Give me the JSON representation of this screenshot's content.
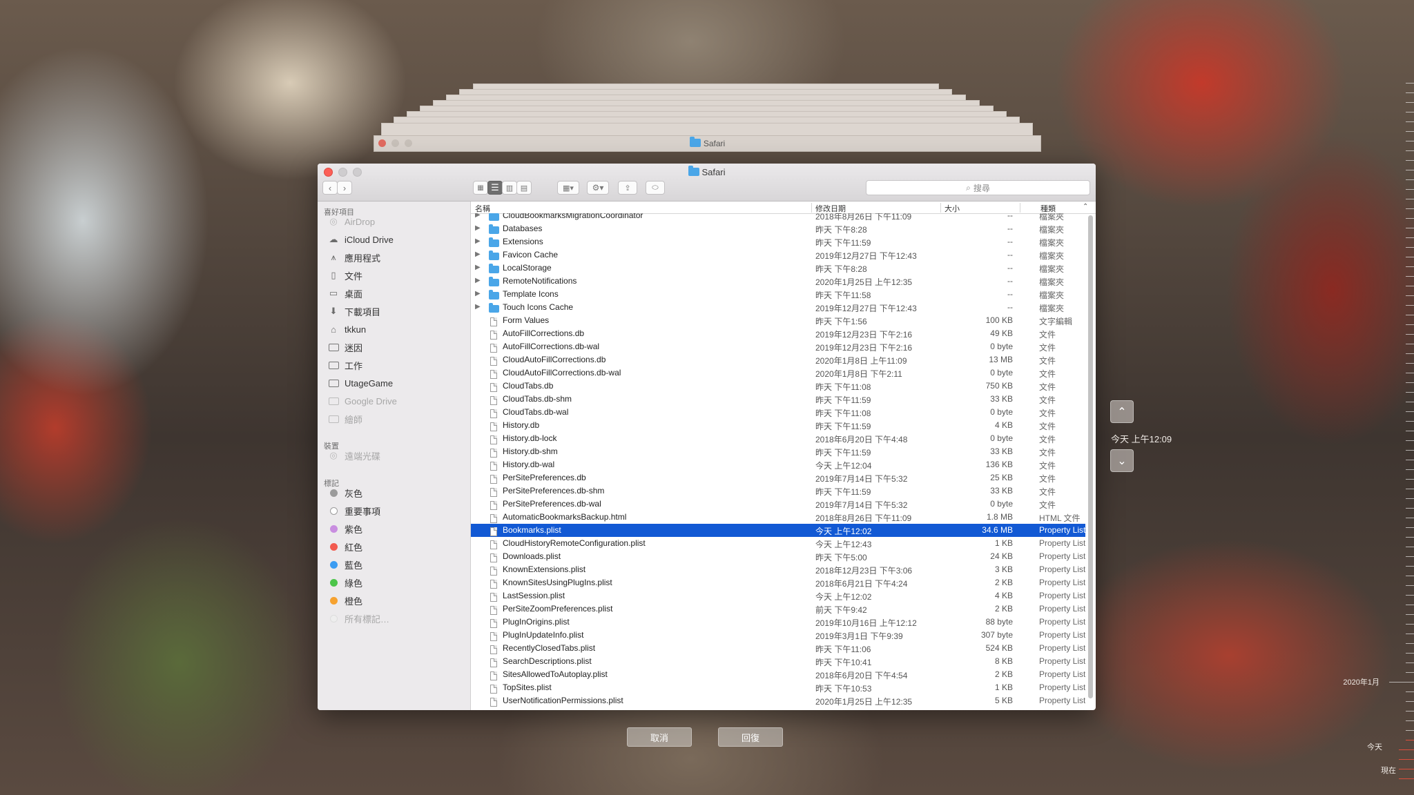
{
  "window": {
    "title": "Safari",
    "back_title": "Safari"
  },
  "toolbar": {
    "search_placeholder": "搜尋"
  },
  "sidebar": {
    "favorites_header": "喜好項目",
    "favorites": [
      {
        "label": "AirDrop",
        "icon": "airdrop-icon",
        "dim": true
      },
      {
        "label": "iCloud Drive",
        "icon": "cloud-icon"
      },
      {
        "label": "應用程式",
        "icon": "applications-icon"
      },
      {
        "label": "文件",
        "icon": "document-icon"
      },
      {
        "label": "桌面",
        "icon": "desktop-icon"
      },
      {
        "label": "下載項目",
        "icon": "downloads-icon"
      },
      {
        "label": "tkkun",
        "icon": "home-icon"
      },
      {
        "label": "迷因",
        "icon": "folder-icon"
      },
      {
        "label": "工作",
        "icon": "folder-icon"
      },
      {
        "label": "UtageGame",
        "icon": "folder-icon"
      },
      {
        "label": "Google Drive",
        "icon": "folder-icon",
        "dim": true
      },
      {
        "label": "繪師",
        "icon": "folder-icon",
        "dim": true
      }
    ],
    "devices_header": "裝置",
    "devices": [
      {
        "label": "遠端光碟",
        "icon": "disc-icon",
        "dim": true
      }
    ],
    "tags_header": "標記",
    "tags": [
      {
        "label": "灰色",
        "color": "#9b9b9b"
      },
      {
        "label": "重要事項",
        "color": "#ffffff"
      },
      {
        "label": "紫色",
        "color": "#c98ee0"
      },
      {
        "label": "紅色",
        "color": "#f25a4f"
      },
      {
        "label": "藍色",
        "color": "#3b9cf2"
      },
      {
        "label": "綠色",
        "color": "#4cc54a"
      },
      {
        "label": "橙色",
        "color": "#f6a230"
      },
      {
        "label": "所有標記…",
        "color": "",
        "dim": true
      }
    ]
  },
  "columns": {
    "name": "名稱",
    "date": "修改日期",
    "size": "大小",
    "kind": "種類"
  },
  "files": [
    {
      "name": "CloudBookmarksMigrationCoordinator",
      "date": "2018年8月26日 下午11:09",
      "size": "--",
      "kind": "檔案夾",
      "folder": true
    },
    {
      "name": "Databases",
      "date": "昨天 下午8:28",
      "size": "--",
      "kind": "檔案夾",
      "folder": true
    },
    {
      "name": "Extensions",
      "date": "昨天 下午11:59",
      "size": "--",
      "kind": "檔案夾",
      "folder": true
    },
    {
      "name": "Favicon Cache",
      "date": "2019年12月27日 下午12:43",
      "size": "--",
      "kind": "檔案夾",
      "folder": true
    },
    {
      "name": "LocalStorage",
      "date": "昨天 下午8:28",
      "size": "--",
      "kind": "檔案夾",
      "folder": true
    },
    {
      "name": "RemoteNotifications",
      "date": "2020年1月25日 上午12:35",
      "size": "--",
      "kind": "檔案夾",
      "folder": true
    },
    {
      "name": "Template Icons",
      "date": "昨天 下午11:58",
      "size": "--",
      "kind": "檔案夾",
      "folder": true
    },
    {
      "name": "Touch Icons Cache",
      "date": "2019年12月27日 下午12:43",
      "size": "--",
      "kind": "檔案夾",
      "folder": true
    },
    {
      "name": "Form Values",
      "date": "昨天 下午1:56",
      "size": "100 KB",
      "kind": "文字編輯"
    },
    {
      "name": "AutoFillCorrections.db",
      "date": "2019年12月23日 下午2:16",
      "size": "49 KB",
      "kind": "文件"
    },
    {
      "name": "AutoFillCorrections.db-wal",
      "date": "2019年12月23日 下午2:16",
      "size": "0 byte",
      "kind": "文件"
    },
    {
      "name": "CloudAutoFillCorrections.db",
      "date": "2020年1月8日 上午11:09",
      "size": "13 MB",
      "kind": "文件"
    },
    {
      "name": "CloudAutoFillCorrections.db-wal",
      "date": "2020年1月8日 下午2:11",
      "size": "0 byte",
      "kind": "文件"
    },
    {
      "name": "CloudTabs.db",
      "date": "昨天 下午11:08",
      "size": "750 KB",
      "kind": "文件"
    },
    {
      "name": "CloudTabs.db-shm",
      "date": "昨天 下午11:59",
      "size": "33 KB",
      "kind": "文件"
    },
    {
      "name": "CloudTabs.db-wal",
      "date": "昨天 下午11:08",
      "size": "0 byte",
      "kind": "文件"
    },
    {
      "name": "History.db",
      "date": "昨天 下午11:59",
      "size": "4 KB",
      "kind": "文件"
    },
    {
      "name": "History.db-lock",
      "date": "2018年6月20日 下午4:48",
      "size": "0 byte",
      "kind": "文件"
    },
    {
      "name": "History.db-shm",
      "date": "昨天 下午11:59",
      "size": "33 KB",
      "kind": "文件"
    },
    {
      "name": "History.db-wal",
      "date": "今天 上午12:04",
      "size": "136 KB",
      "kind": "文件"
    },
    {
      "name": "PerSitePreferences.db",
      "date": "2019年7月14日 下午5:32",
      "size": "25 KB",
      "kind": "文件"
    },
    {
      "name": "PerSitePreferences.db-shm",
      "date": "昨天 下午11:59",
      "size": "33 KB",
      "kind": "文件"
    },
    {
      "name": "PerSitePreferences.db-wal",
      "date": "2019年7月14日 下午5:32",
      "size": "0 byte",
      "kind": "文件"
    },
    {
      "name": "AutomaticBookmarksBackup.html",
      "date": "2018年8月26日 下午11:09",
      "size": "1.8 MB",
      "kind": "HTML 文件"
    },
    {
      "name": "Bookmarks.plist",
      "date": "今天 上午12:02",
      "size": "34.6 MB",
      "kind": "Property List",
      "selected": true
    },
    {
      "name": "CloudHistoryRemoteConfiguration.plist",
      "date": "今天 上午12:43",
      "size": "1 KB",
      "kind": "Property List"
    },
    {
      "name": "Downloads.plist",
      "date": "昨天 下午5:00",
      "size": "24 KB",
      "kind": "Property List"
    },
    {
      "name": "KnownExtensions.plist",
      "date": "2018年12月23日 下午3:06",
      "size": "3 KB",
      "kind": "Property List"
    },
    {
      "name": "KnownSitesUsingPlugIns.plist",
      "date": "2018年6月21日 下午4:24",
      "size": "2 KB",
      "kind": "Property List"
    },
    {
      "name": "LastSession.plist",
      "date": "今天 上午12:02",
      "size": "4 KB",
      "kind": "Property List"
    },
    {
      "name": "PerSiteZoomPreferences.plist",
      "date": "前天 下午9:42",
      "size": "2 KB",
      "kind": "Property List"
    },
    {
      "name": "PlugInOrigins.plist",
      "date": "2019年10月16日 上午12:12",
      "size": "88 byte",
      "kind": "Property List"
    },
    {
      "name": "PlugInUpdateInfo.plist",
      "date": "2019年3月1日 下午9:39",
      "size": "307 byte",
      "kind": "Property List"
    },
    {
      "name": "RecentlyClosedTabs.plist",
      "date": "昨天 下午11:06",
      "size": "524 KB",
      "kind": "Property List"
    },
    {
      "name": "SearchDescriptions.plist",
      "date": "昨天 下午10:41",
      "size": "8 KB",
      "kind": "Property List"
    },
    {
      "name": "SitesAllowedToAutoplay.plist",
      "date": "2018年6月20日 下午4:54",
      "size": "2 KB",
      "kind": "Property List"
    },
    {
      "name": "TopSites.plist",
      "date": "昨天 下午10:53",
      "size": "1 KB",
      "kind": "Property List"
    },
    {
      "name": "UserNotificationPermissions.plist",
      "date": "2020年1月25日 上午12:35",
      "size": "5 KB",
      "kind": "Property List"
    }
  ],
  "actions": {
    "cancel": "取消",
    "restore": "回復"
  },
  "timemachine": {
    "current": "今天 上午12:09",
    "label_month": "2020年1月",
    "label_today": "今天",
    "label_now": "現在"
  }
}
